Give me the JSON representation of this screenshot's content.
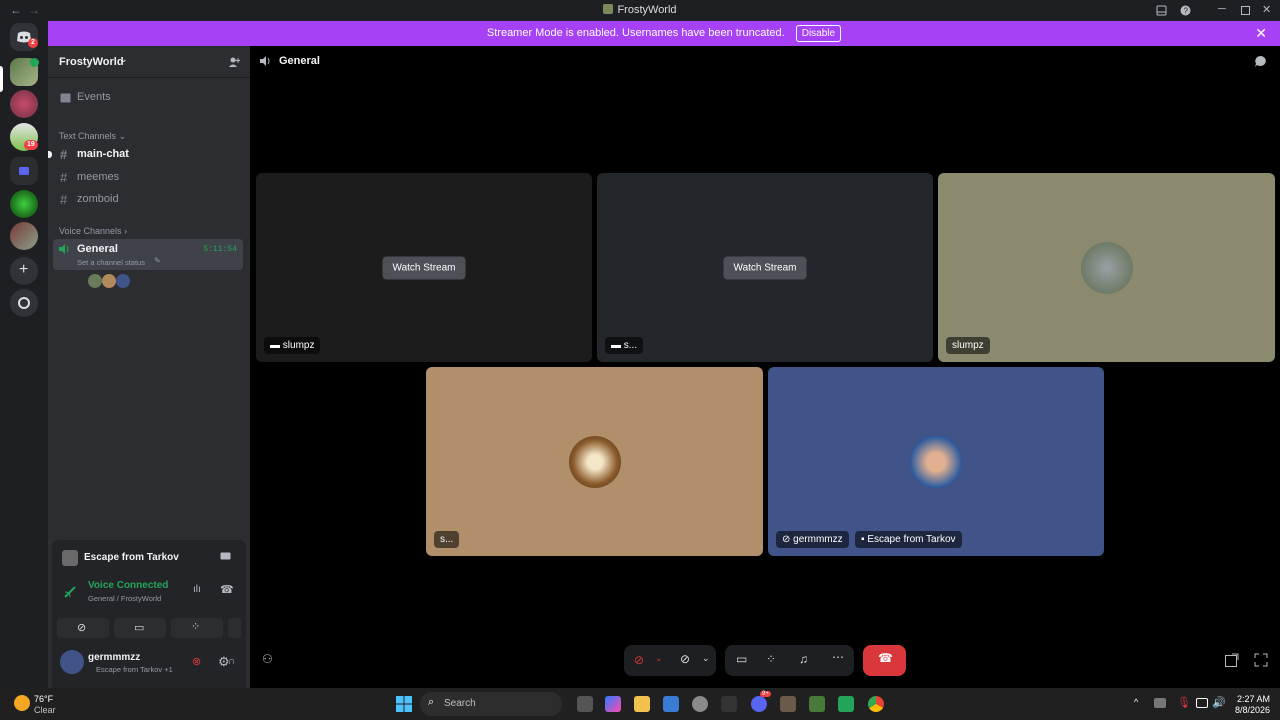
{
  "window": {
    "title": "FrostyWorld",
    "back": "←",
    "forward": "→"
  },
  "banner": {
    "text": "Streamer Mode is enabled. Usernames have been truncated.",
    "action": "Disable",
    "close": "✕"
  },
  "guilds": {
    "home_badge": "2",
    "badge_19": "19"
  },
  "server": {
    "name": "FrostyWorld",
    "events_label": "Events",
    "text_category": "Text Channels",
    "text_channels": [
      "main-chat",
      "meemes",
      "zomboid"
    ],
    "voice_category": "Voice Channels",
    "voice_channel": {
      "name": "General",
      "timer": "5:11:54",
      "status_placeholder": "Set a channel status"
    }
  },
  "activity": {
    "game": "Escape from Tarkov"
  },
  "voice_panel": {
    "status": "Voice Connected",
    "location": "General / FrostyWorld"
  },
  "user": {
    "name": "germmmzz",
    "status": "Escape from Tarkov +1"
  },
  "main": {
    "channel_title": "General",
    "tiles": [
      {
        "label": "slumpz",
        "watch": "Watch Stream"
      },
      {
        "label": "s...",
        "watch": "Watch Stream"
      },
      {
        "label": "slumpz"
      },
      {
        "label": "s..."
      },
      {
        "label": "germmmzz",
        "activity": "Escape from Tarkov"
      }
    ]
  },
  "colors": {
    "accent": "#a641f5",
    "green": "#23a559",
    "red": "#da373c",
    "blurple": "#5865f2",
    "tile3": "#8b8a6e",
    "tile4": "#b08f6a",
    "tile5": "#40548a"
  },
  "taskbar": {
    "temp": "76°F",
    "weather": "Clear",
    "search": "Search",
    "time": "2:27 AM",
    "date": "8/8/2026",
    "discord_badge": "9+"
  }
}
